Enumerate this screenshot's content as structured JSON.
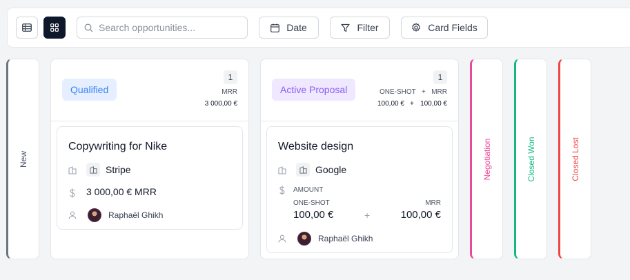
{
  "toolbar": {
    "list_view_icon": "list-icon",
    "board_view_icon": "grid-icon",
    "search_placeholder": "Search opportunities...",
    "date_label": "Date",
    "filter_label": "Filter",
    "card_fields_label": "Card Fields"
  },
  "columns": {
    "new": {
      "label": "New",
      "color": "#6b7280"
    },
    "qualified": {
      "label": "Qualified",
      "count": "1",
      "metric_label": "MRR",
      "metric_value": "3 000,00 €",
      "badge_bg": "#e5efff",
      "badge_color": "#3b82f6",
      "card": {
        "title": "Copywriting for Nike",
        "company": "Stripe",
        "amount": "3 000,00 € MRR",
        "owner": "Raphaël Ghikh"
      }
    },
    "active_proposal": {
      "label": "Active Proposal",
      "count": "1",
      "metric_label_1": "ONE-SHOT",
      "metric_plus": "+",
      "metric_label_2": "MRR",
      "metric_value_1": "100,00 €",
      "metric_value_2": "100,00 €",
      "badge_bg": "#efe8ff",
      "badge_color": "#8b5cf6",
      "card": {
        "title": "Website design",
        "company": "Google",
        "amount_label": "AMOUNT",
        "oneshot_label": "ONE-SHOT",
        "mrr_label": "MRR",
        "oneshot_value": "100,00 €",
        "plus": "+",
        "mrr_value": "100,00 €",
        "owner": "Raphaël Ghikh"
      }
    },
    "negotiation": {
      "label": "Negotiation",
      "color": "#ec4899"
    },
    "closed_won": {
      "label": "Closed Won",
      "color": "#10b981"
    },
    "closed_lost": {
      "label": "Closed Lost",
      "color": "#ef4444"
    }
  }
}
